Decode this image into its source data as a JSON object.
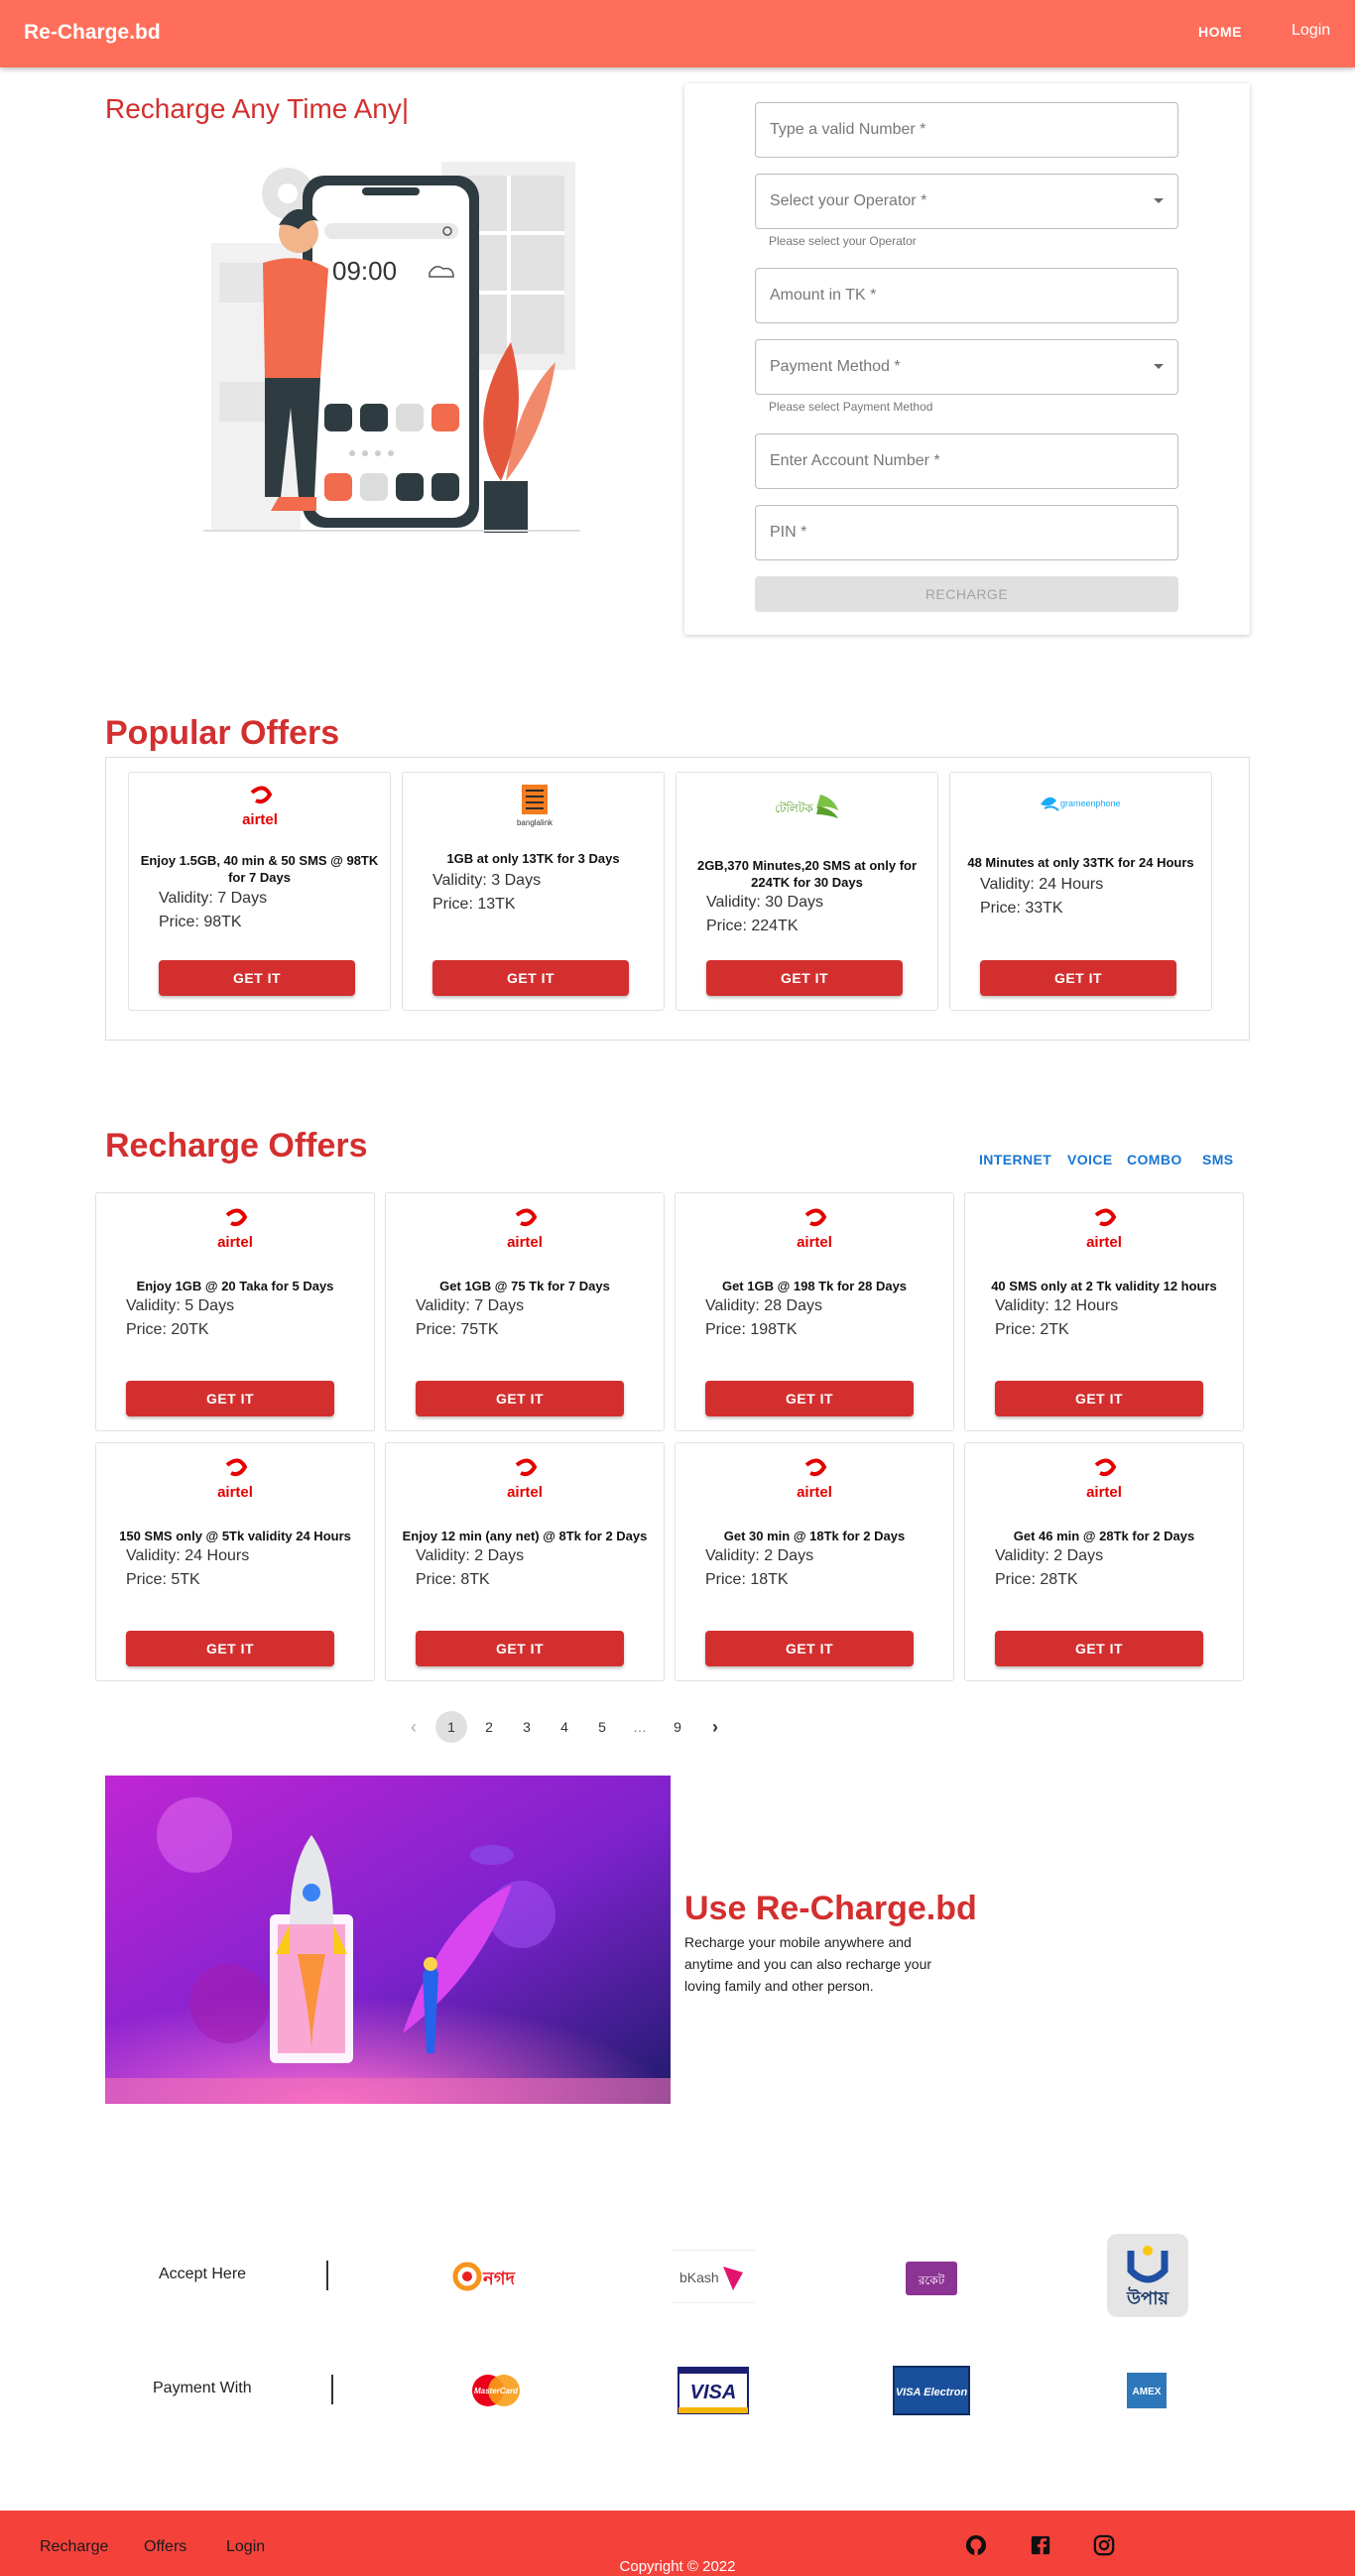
{
  "header": {
    "brand": "Re-Charge.bd",
    "nav_home": "HOME",
    "nav_login": "Login"
  },
  "hero": {
    "title": "Recharge Any Time Any|",
    "clock_time": "09:00",
    "form": {
      "number_placeholder": "Type a valid Number *",
      "operator_placeholder": "Select your Operator *",
      "operator_helper": "Please select your Operator",
      "amount_placeholder": "Amount in TK *",
      "payment_placeholder": "Payment Method *",
      "payment_helper": "Please select Payment Method",
      "account_placeholder": "Enter Account Number *",
      "pin_placeholder": "PIN *",
      "submit_label": "RECHARGE"
    }
  },
  "popular": {
    "title": "Popular Offers",
    "offers": [
      {
        "operator": "airtel",
        "title": "Enjoy 1.5GB, 40 min & 50 SMS @ 98TK for 7 Days",
        "validity": "Validity: 7 Days",
        "price": "Price: 98TK",
        "button": "GET IT"
      },
      {
        "operator": "banglalink",
        "title": "1GB at only 13TK for 3 Days",
        "validity": "Validity: 3 Days",
        "price": "Price: 13TK",
        "button": "GET IT"
      },
      {
        "operator": "teletalk",
        "title": "2GB,370 Minutes,20 SMS at only for 224TK for 30 Days",
        "validity": "Validity: 30 Days",
        "price": "Price: 224TK",
        "button": "GET IT"
      },
      {
        "operator": "grameenphone",
        "title": "48 Minutes at only 33TK for 24 Hours",
        "validity": "Validity: 24 Hours",
        "price": "Price: 33TK",
        "button": "GET IT"
      }
    ],
    "logo_labels": {
      "airtel": "airtel",
      "banglalink": "banglalink",
      "teletalk": "টেলিটক",
      "grameenphone": "grameenphone"
    }
  },
  "recharge": {
    "title": "Recharge Offers",
    "tabs": [
      "INTERNET",
      "VOICE",
      "COMBO",
      "SMS"
    ],
    "offers": [
      {
        "title": "Enjoy 1GB @ 20 Taka for 5 Days",
        "validity": "Validity: 5 Days",
        "price": "Price: 20TK",
        "button": "GET IT"
      },
      {
        "title": "Get 1GB @ 75 Tk for 7 Days",
        "validity": "Validity: 7 Days",
        "price": "Price: 75TK",
        "button": "GET IT"
      },
      {
        "title": "Get 1GB @ 198 Tk for 28 Days",
        "validity": "Validity: 28 Days",
        "price": "Price: 198TK",
        "button": "GET IT"
      },
      {
        "title": "40 SMS only at 2 Tk validity 12 hours",
        "validity": "Validity: 12 Hours",
        "price": "Price: 2TK",
        "button": "GET IT"
      },
      {
        "title": "150 SMS only @ 5Tk validity 24 Hours",
        "validity": "Validity: 24 Hours",
        "price": "Price: 5TK",
        "button": "GET IT"
      },
      {
        "title": "Enjoy 12 min (any net) @ 8Tk for 2 Days",
        "validity": "Validity: 2 Days",
        "price": "Price: 8TK",
        "button": "GET IT"
      },
      {
        "title": "Get 30 min @ 18Tk for 2 Days",
        "validity": "Validity: 2 Days",
        "price": "Price: 18TK",
        "button": "GET IT"
      },
      {
        "title": "Get 46 min @ 28Tk for 2 Days",
        "validity": "Validity: 2 Days",
        "price": "Price: 28TK",
        "button": "GET IT"
      }
    ],
    "logo_label": "airtel",
    "pagination": {
      "prev": "‹",
      "pages": [
        "1",
        "2",
        "3",
        "4",
        "5",
        "…",
        "9"
      ],
      "current": "1",
      "next": "›"
    }
  },
  "promo": {
    "title": "Use Re-Charge.bd",
    "text": "Recharge your mobile anywhere and anytime and you can also recharge your loving family and other person."
  },
  "payment": {
    "accept_label": "Accept Here",
    "pay_label": "Payment With",
    "accept_logos": [
      "নগদ",
      "bKash",
      "রকেট",
      "উপায়"
    ],
    "card_logos": [
      "MasterCard",
      "VISA",
      "VISA Electron",
      "AMEX"
    ]
  },
  "footer": {
    "links": [
      "Recharge",
      "Offers",
      "Login"
    ],
    "icons": [
      "github-icon",
      "facebook-icon",
      "instagram-icon"
    ],
    "copyright": "Copyright © 2022"
  }
}
